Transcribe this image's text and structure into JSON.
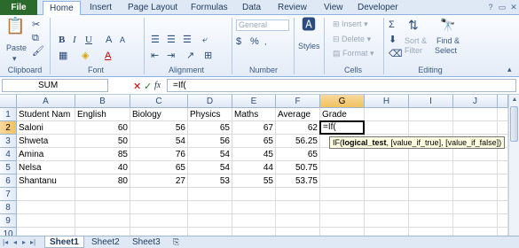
{
  "tabs": [
    "File",
    "Home",
    "Insert",
    "Page Layout",
    "Formulas",
    "Data",
    "Review",
    "View",
    "Developer"
  ],
  "ribbon": {
    "clipboard": {
      "paste": "Paste",
      "label": "Clipboard"
    },
    "font": {
      "label": "Font"
    },
    "alignment": {
      "label": "Alignment"
    },
    "number": {
      "format": "General",
      "label": "Number"
    },
    "styles": {
      "button": "Styles"
    },
    "cells": {
      "insert": "Insert",
      "delete": "Delete",
      "format": "Format",
      "label": "Cells"
    },
    "editing": {
      "sort": "Sort &",
      "filter": "Filter",
      "find": "Find &",
      "select": "Select",
      "label": "Editing"
    }
  },
  "formula_bar": {
    "name_box": "SUM",
    "fx": "fx",
    "value": "=If("
  },
  "columns": [
    "A",
    "B",
    "C",
    "D",
    "E",
    "F",
    "G",
    "H",
    "I",
    "J"
  ],
  "rows": [
    "1",
    "2",
    "3",
    "4",
    "5",
    "6",
    "7",
    "8",
    "9",
    "10"
  ],
  "table": {
    "header": [
      "Student Nam",
      "English",
      "Biology",
      "Physics",
      "Maths",
      "Average",
      "Grade"
    ],
    "data": [
      [
        "Saloni",
        "60",
        "56",
        "65",
        "67",
        "62"
      ],
      [
        "Shweta",
        "50",
        "54",
        "56",
        "65",
        "56.25"
      ],
      [
        "Amina",
        "85",
        "76",
        "54",
        "45",
        "65"
      ],
      [
        "Nelsa",
        "40",
        "65",
        "54",
        "44",
        "50.75"
      ],
      [
        "Shantanu",
        "80",
        "27",
        "53",
        "55",
        "53.75"
      ]
    ]
  },
  "active_cell_value": "=If(",
  "tooltip": {
    "fn": "IF(",
    "arg1": "logical_test",
    "rest": ", [value_if_true], [value_if_false])"
  },
  "sheets": [
    "Sheet1",
    "Sheet2",
    "Sheet3"
  ]
}
